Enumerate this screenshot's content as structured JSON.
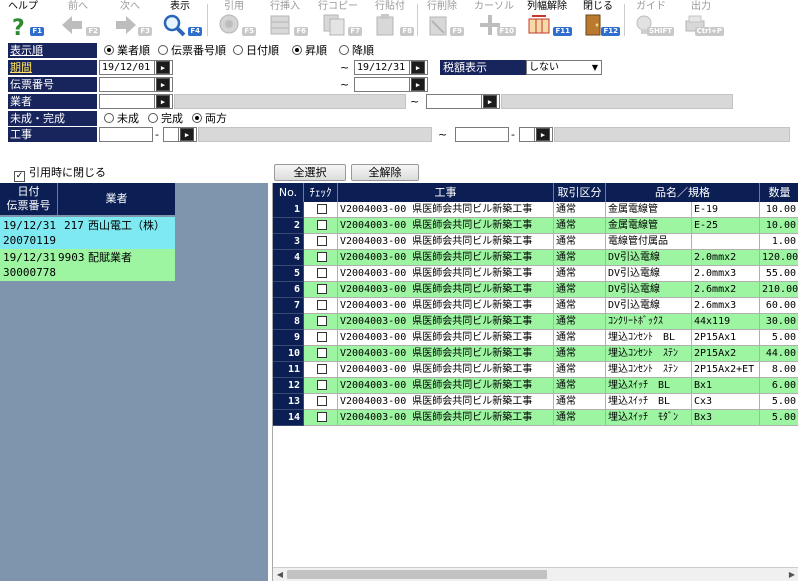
{
  "toolbar": [
    {
      "label": "ヘルプ",
      "key": "F1",
      "icon": "help-icon",
      "enabled": true
    },
    {
      "label": "前へ",
      "key": "F2",
      "icon": "arrow-left-icon",
      "enabled": false
    },
    {
      "label": "次へ",
      "key": "F3",
      "icon": "arrow-right-icon",
      "enabled": false
    },
    {
      "label": "表示",
      "key": "F4",
      "icon": "magnifier-icon",
      "enabled": true
    },
    {
      "label": "引用",
      "key": "F5",
      "icon": "quote-icon",
      "enabled": false
    },
    {
      "label": "行挿入",
      "key": "F6",
      "icon": "row-insert-icon",
      "enabled": false
    },
    {
      "label": "行コピー",
      "key": "F7",
      "icon": "row-copy-icon",
      "enabled": false
    },
    {
      "label": "行貼付",
      "key": "F8",
      "icon": "row-paste-icon",
      "enabled": false
    },
    {
      "label": "行削除",
      "key": "F9",
      "icon": "row-delete-icon",
      "enabled": false
    },
    {
      "label": "カーソル",
      "key": "F10",
      "icon": "cursor-icon",
      "enabled": false
    },
    {
      "label": "列幅解除",
      "key": "F11",
      "icon": "column-width-icon",
      "enabled": true
    },
    {
      "label": "閉じる",
      "key": "F12",
      "icon": "close-door-icon",
      "enabled": true
    },
    {
      "label": "ガイド",
      "key": "SHIFT",
      "icon": "guide-bulb-icon",
      "enabled": false
    },
    {
      "label": "出力",
      "key": "Ctrl+P",
      "icon": "output-icon",
      "enabled": false
    }
  ],
  "filters": {
    "display_order": {
      "label": "表示順",
      "options": [
        "業者順",
        "伝票番号順",
        "日付順"
      ],
      "selected": 0,
      "dir_options": [
        "昇順",
        "降順"
      ],
      "dir_selected": 0
    },
    "period": {
      "label": "期間",
      "from": "19/12/01",
      "to": "19/12/31",
      "tilde": "~"
    },
    "tax": {
      "label": "税額表示",
      "value": "しない"
    },
    "slip": {
      "label": "伝票番号",
      "from": "",
      "to": ""
    },
    "vendor": {
      "label": "業者",
      "tilde": "~"
    },
    "status": {
      "label": "未成・完成",
      "options": [
        "未成",
        "完成",
        "両方"
      ],
      "selected": 2
    },
    "construction": {
      "label": "工事",
      "dash": "-",
      "tilde": "~"
    }
  },
  "quote_close": {
    "label": "引用時に閉じる",
    "checked": true
  },
  "buttons": {
    "select_all": "全選択",
    "deselect_all": "全解除"
  },
  "left_list": {
    "headers": {
      "date": "日付",
      "slip": "伝票番号",
      "vendor": "業者"
    },
    "rows": [
      {
        "date": "19/12/31",
        "code": "217",
        "vendor": "西山電工（株）",
        "slip": "20070119",
        "color": "#7fe9f1"
      },
      {
        "date": "19/12/31",
        "code": "9903",
        "vendor": "配賦業者",
        "slip": "30000778",
        "color": "#9df5a2"
      }
    ]
  },
  "detail_table": {
    "headers": {
      "no": "No.",
      "check": "ﾁｪｯｸ",
      "work": "工事",
      "trade": "取引区分",
      "item": "品名／規格",
      "qty": "数量"
    },
    "rows": [
      {
        "no": "1",
        "work": "V2004003-00 県医師会共同ビル新築工事",
        "trade": "通常",
        "name": "金属電線管",
        "spec": "E-19",
        "qty": "10.00",
        "green": false
      },
      {
        "no": "2",
        "work": "V2004003-00 県医師会共同ビル新築工事",
        "trade": "通常",
        "name": "金属電線管",
        "spec": "E-25",
        "qty": "10.00",
        "green": true
      },
      {
        "no": "3",
        "work": "V2004003-00 県医師会共同ビル新築工事",
        "trade": "通常",
        "name": "電線管付属品",
        "spec": "",
        "qty": "1.00",
        "green": false
      },
      {
        "no": "4",
        "work": "V2004003-00 県医師会共同ビル新築工事",
        "trade": "通常",
        "name": "DV引込電線",
        "spec": "2.0mmx2",
        "qty": "120.00",
        "green": true
      },
      {
        "no": "5",
        "work": "V2004003-00 県医師会共同ビル新築工事",
        "trade": "通常",
        "name": "DV引込電線",
        "spec": "2.0mmx3",
        "qty": "55.00",
        "green": false
      },
      {
        "no": "6",
        "work": "V2004003-00 県医師会共同ビル新築工事",
        "trade": "通常",
        "name": "DV引込電線",
        "spec": "2.6mmx2",
        "qty": "210.00",
        "green": true
      },
      {
        "no": "7",
        "work": "V2004003-00 県医師会共同ビル新築工事",
        "trade": "通常",
        "name": "DV引込電線",
        "spec": "2.6mmx3",
        "qty": "60.00",
        "green": false
      },
      {
        "no": "8",
        "work": "V2004003-00 県医師会共同ビル新築工事",
        "trade": "通常",
        "name": "ｺﾝｸﾘｰﾄﾎﾞｯｸｽ",
        "spec": "44x119",
        "qty": "30.00",
        "green": true
      },
      {
        "no": "9",
        "work": "V2004003-00 県医師会共同ビル新築工事",
        "trade": "通常",
        "name": "埋込ｺﾝｾﾝﾄ　BL",
        "spec": "2P15Ax1",
        "qty": "5.00",
        "green": false
      },
      {
        "no": "10",
        "work": "V2004003-00 県医師会共同ビル新築工事",
        "trade": "通常",
        "name": "埋込ｺﾝｾﾝﾄ　ｽﾃﾝ",
        "spec": "2P15Ax2",
        "qty": "44.00",
        "green": true
      },
      {
        "no": "11",
        "work": "V2004003-00 県医師会共同ビル新築工事",
        "trade": "通常",
        "name": "埋込ｺﾝｾﾝﾄ　ｽﾃﾝ",
        "spec": "2P15Ax2+ET",
        "qty": "8.00",
        "green": false
      },
      {
        "no": "12",
        "work": "V2004003-00 県医師会共同ビル新築工事",
        "trade": "通常",
        "name": "埋込ｽｲｯﾁ　BL",
        "spec": "Bx1",
        "qty": "6.00",
        "green": true
      },
      {
        "no": "13",
        "work": "V2004003-00 県医師会共同ビル新築工事",
        "trade": "通常",
        "name": "埋込ｽｲｯﾁ　BL",
        "spec": "Cx3",
        "qty": "5.00",
        "green": false
      },
      {
        "no": "14",
        "work": "V2004003-00 県医師会共同ビル新築工事",
        "trade": "通常",
        "name": "埋込ｽｲｯﾁ　ﾓﾀﾞﾝ",
        "spec": "Bx3",
        "qty": "5.00",
        "green": true
      }
    ]
  },
  "colors": {
    "navy": "#0b1f55",
    "row_green": "#9df5a2",
    "row_cyan": "#7fe9f1",
    "panel_bg": "#7f95ad",
    "fkey_blue": "#2d6ecf"
  }
}
